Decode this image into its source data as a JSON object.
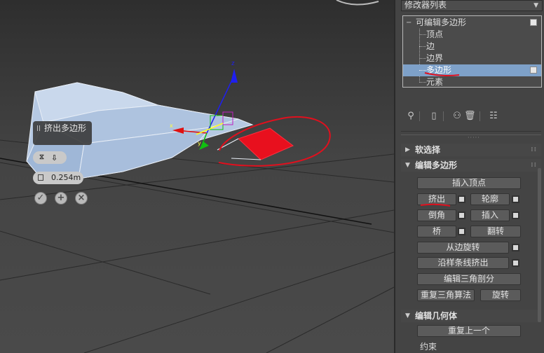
{
  "viewport": {
    "caddy_title": "挤出多边形",
    "caddy_amount": "0.254m",
    "icons": [
      "pause-grip-icon",
      "extrude-mode-icon",
      "dropdown-arrow-icon",
      "height-icon",
      "ok-check-icon",
      "apply-plus-icon",
      "cancel-x-icon"
    ]
  },
  "panel": {
    "modifier_list_label": "修改器列表",
    "stack": {
      "root": "可编辑多边形",
      "items": [
        {
          "label": "顶点",
          "selected": false
        },
        {
          "label": "边",
          "selected": false
        },
        {
          "label": "边界",
          "selected": false
        },
        {
          "label": "多边形",
          "selected": true
        },
        {
          "label": "元素",
          "selected": false
        }
      ]
    },
    "toolbar_icons": [
      "pin-stack-icon",
      "show-end-result-icon",
      "make-unique-icon",
      "remove-modifier-icon",
      "configure-sets-icon"
    ],
    "rollouts": {
      "soft_selection": "软选择",
      "edit_polygons": "编辑多边形",
      "edit_geometry": "编辑几何体"
    },
    "buttons": {
      "insert_vertex": "插入顶点",
      "extrude": "挤出",
      "outline": "轮廓",
      "bevel": "倒角",
      "inset": "插入",
      "bridge": "桥",
      "flip": "翻转",
      "hinge_from_edge": "从边旋转",
      "extrude_along_spline": "沿样条线挤出",
      "edit_triangulation": "编辑三角剖分",
      "retriangulate": "重复三角算法",
      "turn": "旋转",
      "repeat_last": "重复上一个",
      "constraints": "约束"
    }
  },
  "colors": {
    "viewport_bg": "#444444",
    "selection_blue": "#7ea1c9",
    "annotation_red": "#e0101e",
    "mesh_face": "#b9cde6"
  }
}
